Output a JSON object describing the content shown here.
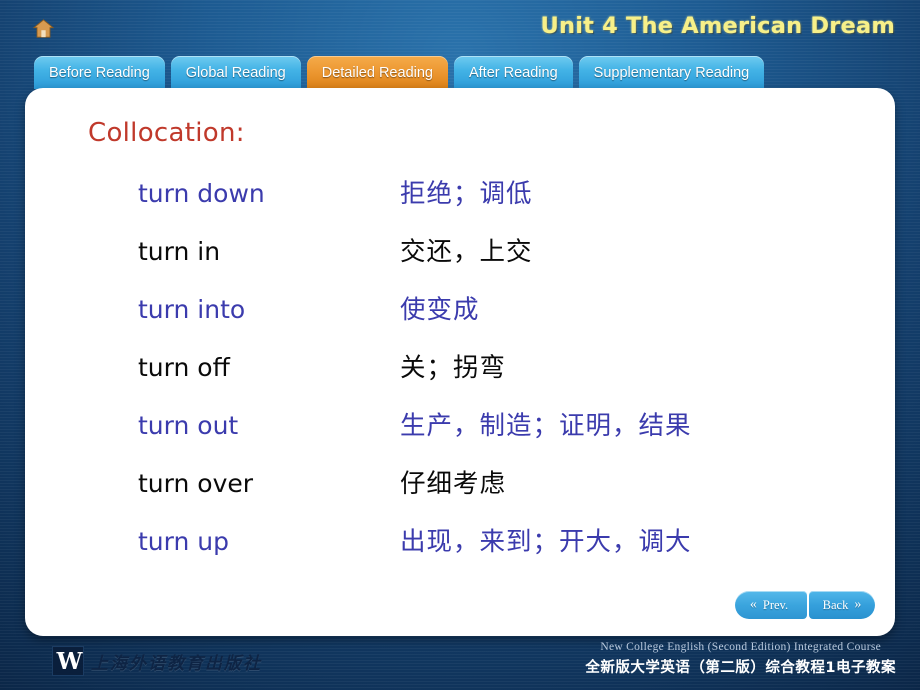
{
  "header": {
    "home_icon": "home-icon",
    "unit_title": "Unit 4 The American Dream"
  },
  "tabs": [
    {
      "label": "Before Reading",
      "active": false
    },
    {
      "label": "Global Reading",
      "active": false
    },
    {
      "label": "Detailed Reading",
      "active": true
    },
    {
      "label": "After Reading",
      "active": false
    },
    {
      "label": "Supplementary Reading",
      "active": false
    }
  ],
  "card": {
    "title": "Collocation:",
    "rows": [
      {
        "phrase": "turn down",
        "meaning": "拒绝；调低",
        "style": "blue"
      },
      {
        "phrase": "turn in",
        "meaning": "交还，上交",
        "style": "dark"
      },
      {
        "phrase": "turn into",
        "meaning": "使变成",
        "style": "blue"
      },
      {
        "phrase": "turn off",
        "meaning": "关；拐弯",
        "style": "dark"
      },
      {
        "phrase": "turn out",
        "meaning": "生产，制造；证明，结果",
        "style": "blue"
      },
      {
        "phrase": "turn over",
        "meaning": "仔细考虑",
        "style": "dark"
      },
      {
        "phrase": "turn up",
        "meaning": "出现，来到；开大，调大",
        "style": "blue"
      }
    ]
  },
  "nav": {
    "prev_label": "Prev.",
    "prev_chevron": "«",
    "back_label": "Back",
    "back_chevron": "»"
  },
  "footer": {
    "publisher_mark": "W",
    "publisher_name": "上海外语教育出版社",
    "course_en": "New College English (Second Edition) Integrated Course",
    "course_zh": "全新版大学英语（第二版）综合教程1电子教案"
  },
  "colors": {
    "accent_orange": "#ed9933",
    "tab_blue": "#43b3e6",
    "title_yellow": "#f7f089",
    "heading_red": "#c0392b",
    "phrase_blue": "#3b3bad"
  }
}
